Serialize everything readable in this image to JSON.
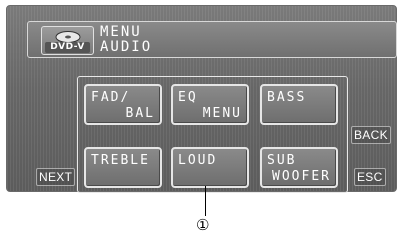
{
  "header": {
    "source_label": "DVD-V",
    "source_icon": "disc-icon",
    "line1": "MENU",
    "line2": "AUDIO"
  },
  "keys": [
    {
      "line1": "FAD/",
      "line2": "BAL"
    },
    {
      "line1": "EQ",
      "line2": "MENU"
    },
    {
      "line1": "BASS",
      "line2": ""
    },
    {
      "line1": "TREBLE",
      "line2": ""
    },
    {
      "line1": "LOUD",
      "line2": ""
    },
    {
      "line1": "SUB",
      "line2": "WOOFER"
    }
  ],
  "softkeys": {
    "next": "NEXT",
    "back": "BACK",
    "esc": "ESC"
  },
  "callout": "①"
}
